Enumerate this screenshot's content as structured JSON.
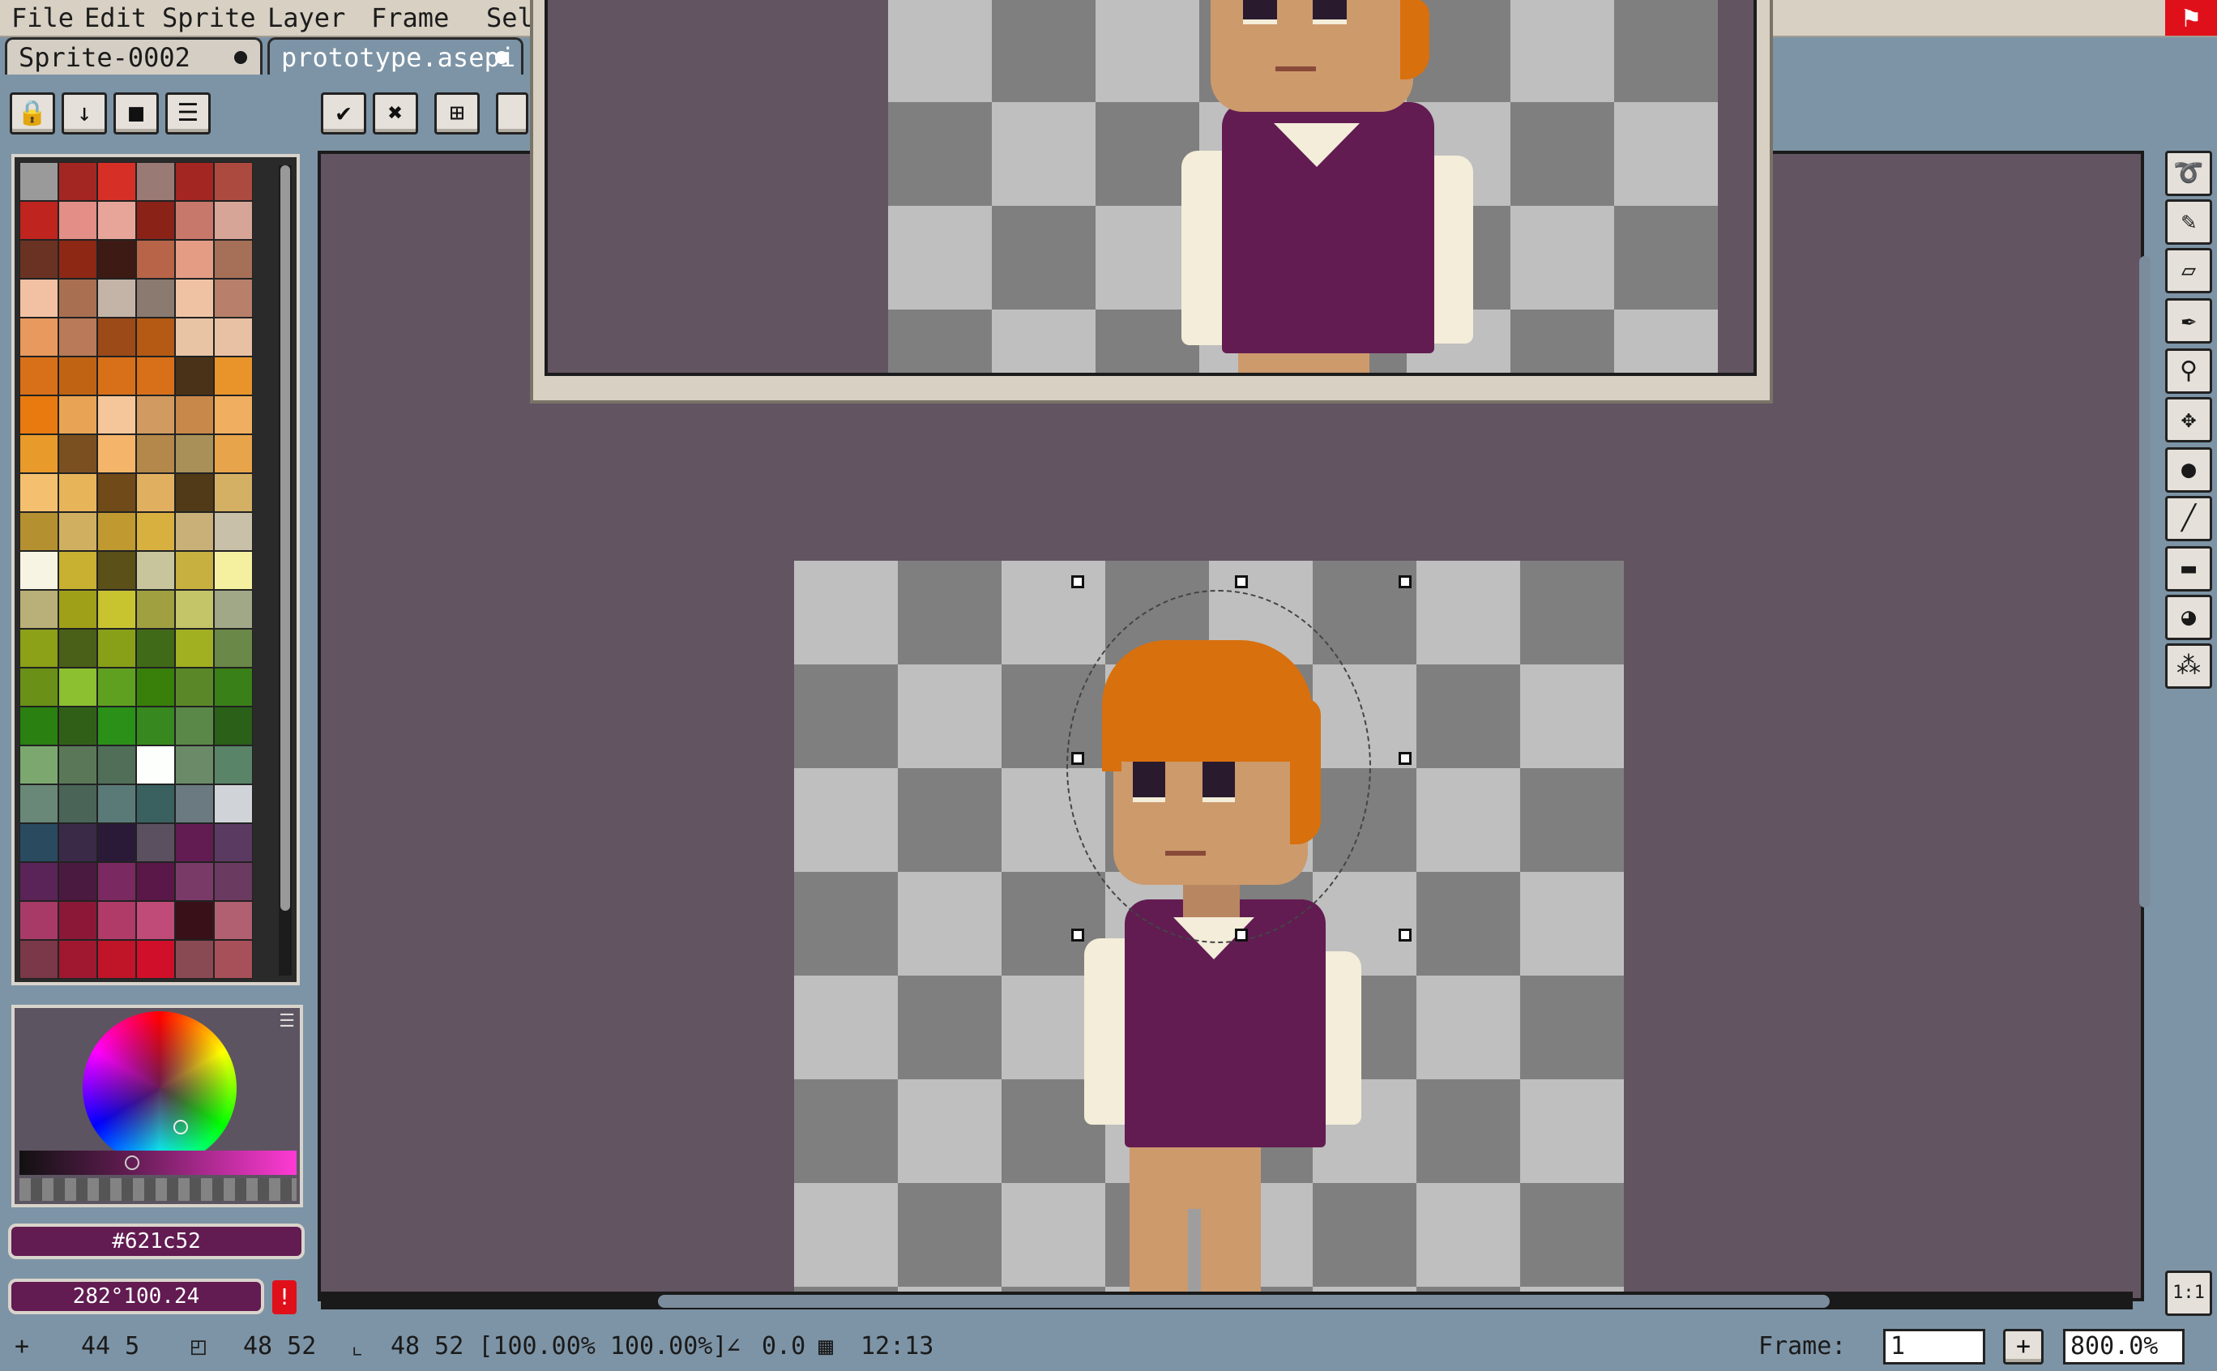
{
  "menu": [
    "File",
    "Edit",
    "Sprite",
    "Layer",
    "Frame",
    "Sel"
  ],
  "tabs": [
    {
      "label": "Sprite-0002"
    },
    {
      "label": "prototype.asepi"
    }
  ],
  "layer_buttons": {
    "lock": "🔒",
    "down": "↓",
    "stop": "■",
    "menu": "☰"
  },
  "action_buttons": {
    "ok": "✔",
    "cancel": "✖",
    "transform": "⊞"
  },
  "palette": [
    "#9a9a9a",
    "#a42622",
    "#d63026",
    "#9a7a74",
    "#a42622",
    "#ad4a40",
    "#c0241e",
    "#e38e86",
    "#e7a59a",
    "#8a2218",
    "#c8786a",
    "#d6a598",
    "#6a3222",
    "#8c2814",
    "#3e1a14",
    "#b86448",
    "#e49c84",
    "#a67058",
    "#f2c0a2",
    "#a87050",
    "#c4b4a8",
    "#8a7a70",
    "#f0c2a4",
    "#b8806a",
    "#e8995e",
    "#b87a58",
    "#9c4a18",
    "#b45a14",
    "#e8c4a4",
    "#e8c0a4",
    "#d8701a",
    "#c06414",
    "#d8701a",
    "#d8701a",
    "#4a3218",
    "#e8942a",
    "#e87a10",
    "#e8a454",
    "#f4c69a",
    "#d09a60",
    "#c8884a",
    "#f0ae60",
    "#e89a2a",
    "#7a5020",
    "#f4b46a",
    "#b4884a",
    "#a89058",
    "#e8a44a",
    "#f4c070",
    "#e8b45a",
    "#704a18",
    "#e0b060",
    "#503a18",
    "#d4b064",
    "#b49030",
    "#d0b060",
    "#c09a30",
    "#d8b040",
    "#c8b078",
    "#c8c0a8",
    "#f8f4e4",
    "#c8b030",
    "#5a5018",
    "#c8c49c",
    "#c8b040",
    "#f4f0a0",
    "#b8b078",
    "#a0a018",
    "#c8c430",
    "#a0a040",
    "#c4c468",
    "#a0a888",
    "#8ca018",
    "#4a6018",
    "#88a018",
    "#406a18",
    "#a0b020",
    "#6a8848",
    "#6a9018",
    "#8cc030",
    "#60a020",
    "#38800a",
    "#5a8828",
    "#3a8018",
    "#2a8010",
    "#306018",
    "#2a9018",
    "#388820",
    "#5a8848",
    "#2a6018",
    "#7ca870",
    "#5a7858",
    "#506e58",
    "#fcfffc",
    "#6a8a68",
    "#5a8468",
    "#6a8878",
    "#4a6458",
    "#5a7a78",
    "#3a6060",
    "#6a7a80",
    "#d0d4d8",
    "#2a4a60",
    "#3a2a48",
    "#2a1a38",
    "#5a5060",
    "#621c52",
    "#5a3a60",
    "#5a2458",
    "#4a1a40",
    "#7a2a60",
    "#5a1848",
    "#7a3a68",
    "#6a3a60",
    "#a83a68",
    "#8c1838",
    "#b03a68",
    "#c04a78",
    "#3a1018",
    "#b06070",
    "#7a3848",
    "#a01830",
    "#c01428",
    "#d0102a",
    "#8a4a54",
    "#a8505a"
  ],
  "colors": {
    "foreground_hex": "#621c52",
    "hsv_text": "282°100.24"
  },
  "tools": [
    "lasso",
    "pencil",
    "eraser",
    "eyedropper",
    "zoom",
    "move",
    "fill",
    "line",
    "rectangle",
    "blur",
    "spray"
  ],
  "zoom_button": "1:1",
  "status": {
    "cursor": "44 5",
    "size": "48  52",
    "selection": "48 52 [100.00% 100.00%]",
    "angle": "0.0",
    "grid": "12:13",
    "frame_label": "Frame:",
    "frame_value": "1",
    "zoom_value": "800.0%"
  }
}
